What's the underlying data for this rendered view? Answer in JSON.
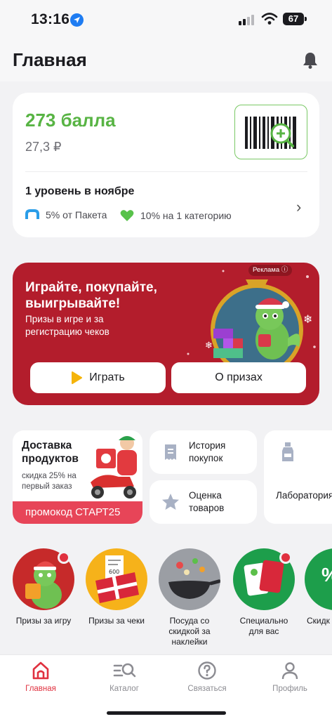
{
  "status_bar": {
    "time": "13:16",
    "battery": "67"
  },
  "header": {
    "title": "Главная"
  },
  "points_card": {
    "points": "273 балла",
    "rub_value": "27,3 ₽",
    "level_title": "1 уровень в ноябре",
    "perks": [
      {
        "label": "5% от Пакета",
        "icon": "paket-icon"
      },
      {
        "label": "10% на 1 категорию",
        "icon": "heart-icon"
      }
    ]
  },
  "promo_banner": {
    "ad_label": "Реклама ⓘ",
    "title": "Играйте, покупайте, выигрывайте!",
    "subtitle": "Призы в игре и за регистрацию чеков",
    "play_button": "Играть",
    "prizes_button": "О призах"
  },
  "tiles": {
    "delivery": {
      "title": "Доставка продуктов",
      "subtitle": "скидка 25% на первый заказ",
      "promo": "промокод СТАРТ25"
    },
    "history": {
      "title": "История покупок",
      "icon": "receipt-icon"
    },
    "rating": {
      "title": "Оценка товаров",
      "icon": "star-icon"
    },
    "lab": {
      "title": "Лаборатория вкуса",
      "icon": "bottle-icon"
    }
  },
  "stories": [
    {
      "label": "Призы за игру",
      "color": "#c62a2a",
      "dot": true
    },
    {
      "label": "Призы за чеки",
      "color": "#f6b21a",
      "dot": false
    },
    {
      "label": "Посуда со скидкой за наклейки",
      "color": "#9b9ea4",
      "dot": false
    },
    {
      "label": "Специально для вас",
      "color": "#1d9e4b",
      "dot": true
    },
    {
      "label": "Скидк",
      "color": "#1d9e4b",
      "dot": false
    }
  ],
  "tab_bar": {
    "items": [
      {
        "label": "Главная",
        "icon": "home-icon",
        "active": true
      },
      {
        "label": "Каталог",
        "icon": "catalog-search-icon",
        "active": false
      },
      {
        "label": "Связаться",
        "icon": "question-icon",
        "active": false
      },
      {
        "label": "Профиль",
        "icon": "profile-icon",
        "active": false
      }
    ]
  },
  "colors": {
    "accent": "#e0313f",
    "points_green": "#58b444",
    "banner_red": "#b31d2c"
  }
}
